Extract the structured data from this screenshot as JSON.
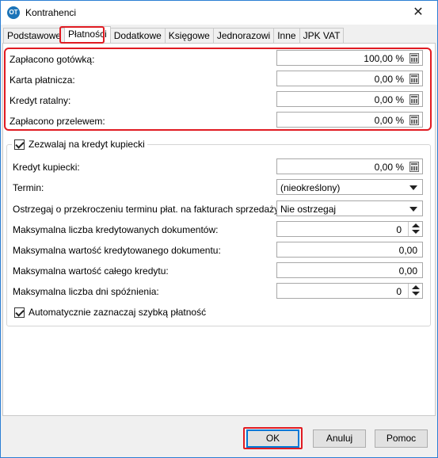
{
  "window": {
    "title": "Kontrahenci",
    "app_icon_text": "OT",
    "close_glyph": "✕"
  },
  "tabs": [
    {
      "label": "Podstawowe",
      "active": false
    },
    {
      "label": "Płatności",
      "active": true
    },
    {
      "label": "Dodatkowe",
      "active": false
    },
    {
      "label": "Księgowe",
      "active": false
    },
    {
      "label": "Jednorazowi",
      "active": false
    },
    {
      "label": "Inne",
      "active": false
    },
    {
      "label": "JPK VAT",
      "active": false
    }
  ],
  "payments": {
    "cash": {
      "label": "Zapłacono gotówką:",
      "value": "100,00 %"
    },
    "card": {
      "label": "Karta płatnicza:",
      "value": "0,00 %"
    },
    "installment": {
      "label": "Kredyt ratalny:",
      "value": "0,00 %"
    },
    "transfer": {
      "label": "Zapłacono przelewem:",
      "value": "0,00 %"
    }
  },
  "credit": {
    "allow_label": "Zezwalaj na kredyt kupiecki",
    "allow_checked": true,
    "merchant_credit": {
      "label": "Kredyt kupiecki:",
      "value": "0,00 %"
    },
    "term": {
      "label": "Termin:",
      "value": "(nieokreślony)"
    },
    "warn": {
      "label": "Ostrzegaj o przekroczeniu terminu płat. na fakturach sprzedaży:",
      "value": "Nie ostrzegaj"
    },
    "max_docs": {
      "label": "Maksymalna liczba kredytowanych dokumentów:",
      "value": "0"
    },
    "max_doc_value": {
      "label": "Maksymalna wartość kredytowanego dokumentu:",
      "value": "0,00"
    },
    "max_total": {
      "label": "Maksymalna wartość całego kredytu:",
      "value": "0,00"
    },
    "max_delay_days": {
      "label": "Maksymalna liczba dni spóźnienia:",
      "value": "0"
    },
    "auto_quick_pay": {
      "label": "Automatycznie zaznaczaj szybką płatność",
      "checked": true
    }
  },
  "buttons": {
    "ok": "OK",
    "cancel": "Anuluj",
    "help": "Pomoc"
  },
  "colors": {
    "highlight": "#e01b22",
    "accent": "#0078d7"
  }
}
